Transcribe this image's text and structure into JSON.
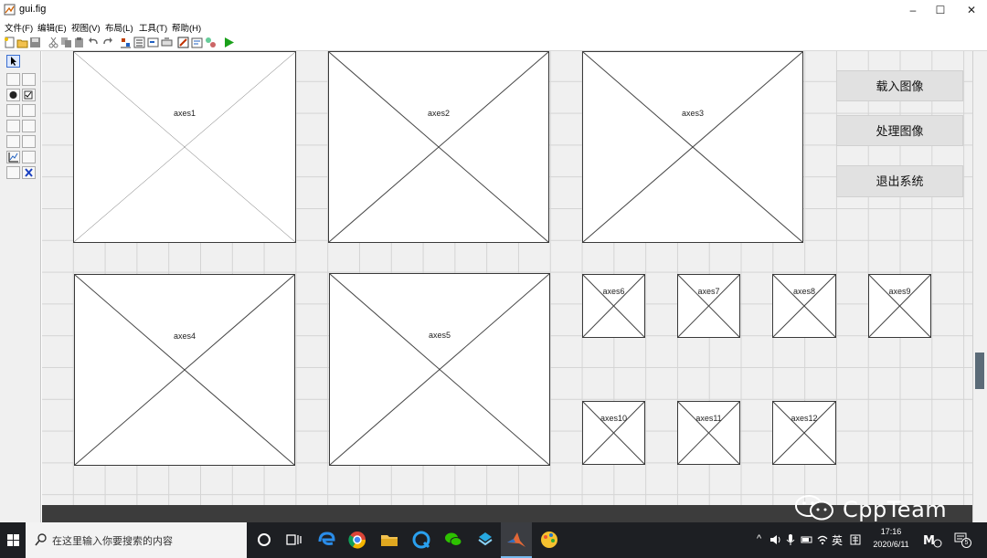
{
  "window": {
    "title": "gui.fig",
    "controls": [
      "–",
      "☐",
      "✕"
    ]
  },
  "menu": [
    "文件(F)",
    "编辑(E)",
    "视图(V)",
    "布局(L)",
    "工具(T)",
    "帮助(H)"
  ],
  "axes": [
    "axes1",
    "axes2",
    "axes3",
    "axes4",
    "axes5",
    "axes6",
    "axes7",
    "axes8",
    "axes9",
    "axes10",
    "axes11",
    "axes12"
  ],
  "buttons": {
    "load": "载入图像",
    "process": "处理图像",
    "exit": "退出系统"
  },
  "taskbar": {
    "search_placeholder": "在这里输入你要搜索的内容",
    "ime": "英",
    "time": "17:16",
    "date": "2020/6/11",
    "notifications": "5"
  },
  "watermark": "CppTeam",
  "colors": {
    "canvas": "#f0f0f0",
    "grid": "#d4d4d4",
    "taskbar": "#1d1f23",
    "button": "#e1e1e1",
    "run_green": "#1aa01a"
  }
}
